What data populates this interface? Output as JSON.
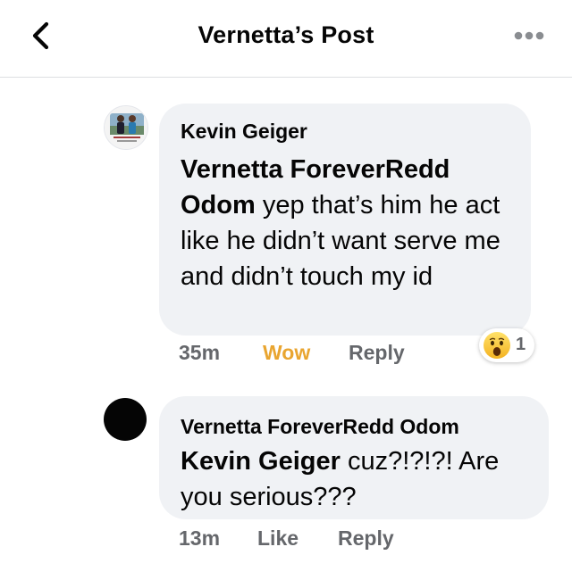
{
  "header": {
    "title": "Vernetta’s Post",
    "back_icon": "chevron-left-icon",
    "more_icon": "more-horizontal-icon"
  },
  "comments": [
    {
      "author": "Kevin Geiger",
      "avatar": "profile-photo",
      "mention": "Vernetta ForeverRedd Odom",
      "text": "yep that’s him he act like he didn’t want serve me and didn’t touch my id",
      "time": "35m",
      "reaction_label": "Wow",
      "reply_label": "Reply",
      "reaction_icon": "wow-emoji-icon",
      "reaction_count": "1"
    },
    {
      "author": "Vernetta ForeverRedd Odom",
      "avatar": "black-circle",
      "mention": "Kevin Geiger",
      "text": "cuz?!?!?! Are you serious???",
      "time": "13m",
      "like_label": "Like",
      "reply_label": "Reply"
    }
  ],
  "colors": {
    "bubble": "#f0f2f5",
    "secondary_text": "#65676b",
    "wow_label": "#e9a530",
    "divider": "#dddfe2"
  }
}
